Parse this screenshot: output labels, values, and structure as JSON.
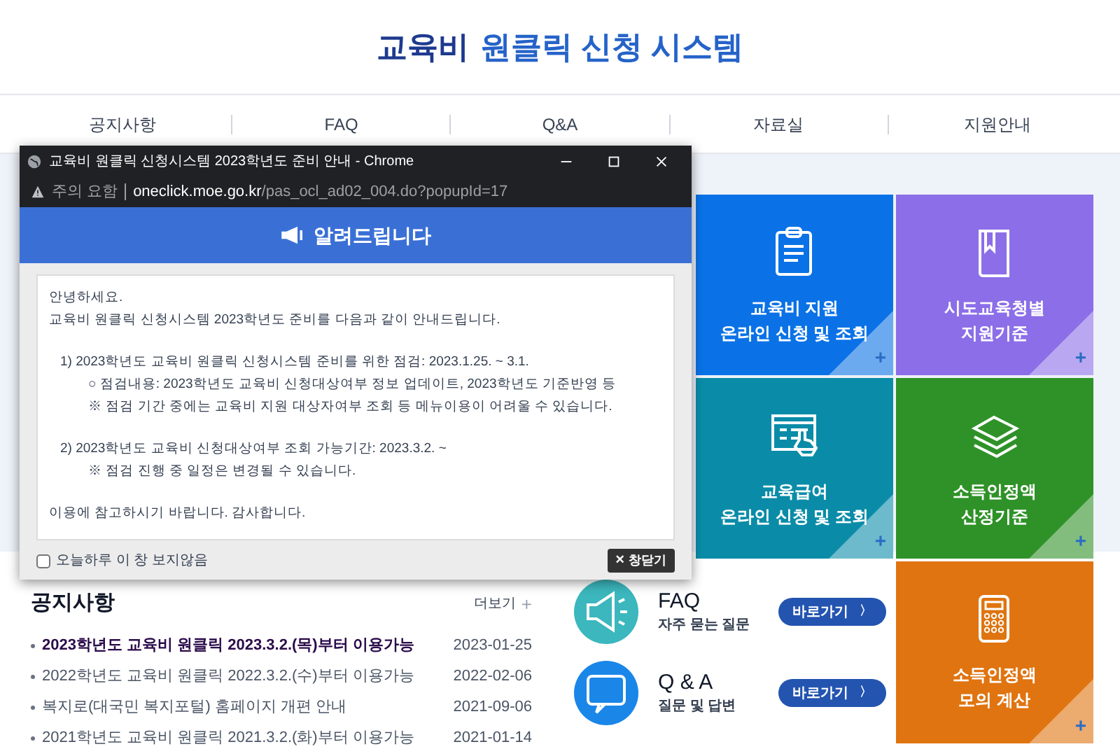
{
  "header": {
    "title_prefix": "교육비",
    "title_rest": "원클릭 신청 시스템"
  },
  "nav": [
    "공지사항",
    "FAQ",
    "Q&A",
    "자료실",
    "지원안내"
  ],
  "tiles": [
    {
      "lines": [
        "교육비 지원",
        "온라인 신청 및 조회"
      ],
      "color": "#0a72e6",
      "plus": "+"
    },
    {
      "lines": [
        "시도교육청별",
        "지원기준"
      ],
      "color": "#8b6ee8",
      "plus": "+"
    },
    {
      "lines": [
        "교육급여",
        "온라인 신청 및 조회"
      ],
      "color": "#0a8ca8",
      "plus": "+"
    },
    {
      "lines": [
        "소득인정액",
        "산정기준"
      ],
      "color": "#2f9228",
      "plus": "+"
    }
  ],
  "calc_tile": {
    "lines": [
      "소득인정액",
      "모의 계산"
    ],
    "color": "#e07410",
    "plus": "+"
  },
  "notices": {
    "title": "공지사항",
    "more": "더보기",
    "more_icon": "+",
    "items": [
      {
        "text": "2023학년도 교육비 원클릭 2023.3.2.(목)부터 이용가능",
        "date": "2023-01-25",
        "highlighted": true
      },
      {
        "text": "2022학년도 교육비 원클릭 2022.3.2.(수)부터 이용가능",
        "date": "2022-02-06",
        "highlighted": false
      },
      {
        "text": "복지로(대국민 복지포털) 홈페이지 개편 안내",
        "date": "2021-09-06",
        "highlighted": false
      },
      {
        "text": "2021학년도 교육비 원클릭 2021.3.2.(화)부터 이용가능",
        "date": "2021-01-14",
        "highlighted": false
      }
    ]
  },
  "shortcuts": [
    {
      "kind": "faq",
      "title": "FAQ",
      "subtitle": "자주 묻는 질문",
      "button": "바로가기",
      "arrow": "〉"
    },
    {
      "kind": "qna",
      "title": "Q & A",
      "subtitle": "질문 및 답변",
      "button": "바로가기",
      "arrow": "〉"
    }
  ],
  "popup": {
    "window_title": "교육비 원클릭 신청시스템 2023학년도 준비 안내 - Chrome",
    "security": "주의 요함",
    "url_host": "oneclick.moe.go.kr",
    "url_path": "/pas_ocl_ad02_004.do?popupId=17",
    "banner": "알려드립니다",
    "body": [
      {
        "kind": "plain",
        "text": "안녕하세요."
      },
      {
        "kind": "plain",
        "text": "교육비 원클릭 신청시스템 2023학년도 준비를 다음과 같이 안내드립니다."
      },
      {
        "kind": "gap"
      },
      {
        "kind": "item",
        "text": "1) 2023학년도 교육비 원클릭 신청시스템 준비를 위한 점검: 2023.1.25. ~ 3.1."
      },
      {
        "kind": "sub",
        "text": "○ 점검내용: 2023학년도 교육비 신청대상여부 정보 업데이트, 2023학년도 기준반영 등"
      },
      {
        "kind": "sub",
        "text": "※ 점검 기간 중에는 교육비 지원 대상자여부 조회 등 메뉴이용이 어려울 수 있습니다."
      },
      {
        "kind": "gap"
      },
      {
        "kind": "item",
        "text": "2) 2023학년도 교육비 신청대상여부 조회 가능기간: 2023.3.2. ~"
      },
      {
        "kind": "sub",
        "text": "※  점검 진행 중 일정은 변경될 수 있습니다."
      },
      {
        "kind": "gap"
      },
      {
        "kind": "plain",
        "text": "이용에 참고하시기 바랍니다. 감사합니다."
      }
    ],
    "dont_show": {
      "label": "오늘하루 이 창 보지않음",
      "checked": false
    },
    "close_button": {
      "icon": "×",
      "label": "창닫기"
    }
  }
}
